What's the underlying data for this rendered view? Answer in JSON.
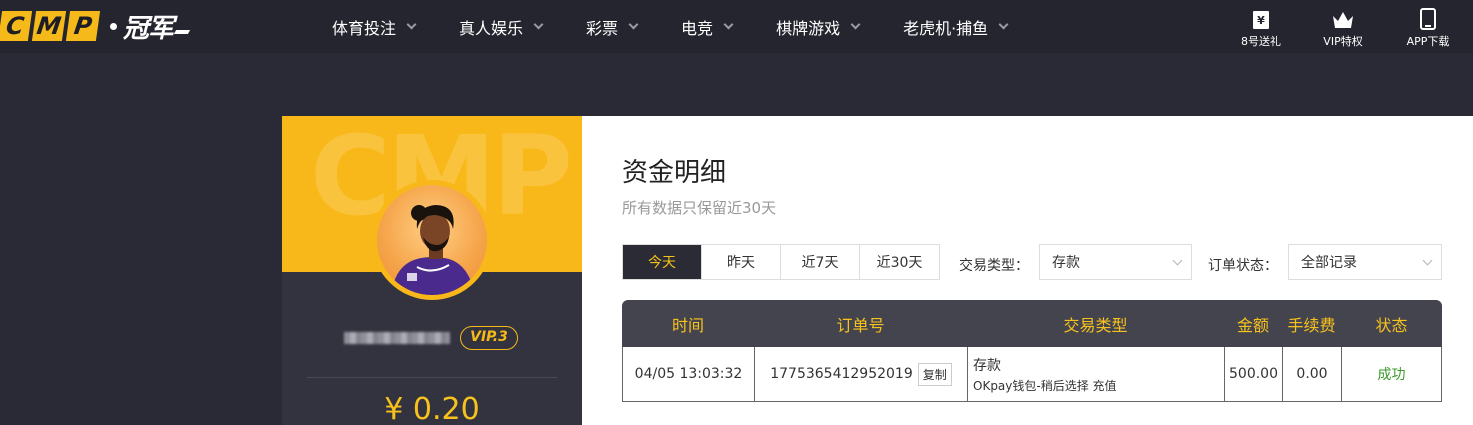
{
  "brand": {
    "logo_letters": [
      "C",
      "M",
      "P"
    ],
    "logo_cn": "冠军"
  },
  "nav": {
    "items": [
      {
        "label": "体育投注"
      },
      {
        "label": "真人娱乐"
      },
      {
        "label": "彩票"
      },
      {
        "label": "电竞"
      },
      {
        "label": "棋牌游戏"
      },
      {
        "label": "老虎机·捕鱼"
      }
    ]
  },
  "header_right": {
    "gift_label": "8号送礼",
    "vip_label": "VIP特权",
    "app_label": "APP下载"
  },
  "profile": {
    "banner_watermark": "CMP",
    "vip_level": "VIP.3",
    "balance": "¥ 0.20"
  },
  "page": {
    "title": "资金明细",
    "subtitle": "所有数据只保留近30天"
  },
  "filters": {
    "range_tabs": [
      "今天",
      "昨天",
      "近7天",
      "近30天"
    ],
    "active_range": "今天",
    "type_label": "交易类型：",
    "type_value": "存款",
    "status_label": "订单状态：",
    "status_value": "全部记录"
  },
  "table": {
    "headers": [
      "时间",
      "订单号",
      "交易类型",
      "金额",
      "手续费",
      "状态"
    ],
    "rows": [
      {
        "time": "04/05 13:03:32",
        "order_no": "1775365412952019",
        "copy_label": "复制",
        "type_main": "存款",
        "type_detail": "OKpay钱包-稍后选择 充值",
        "amount": "500.00",
        "fee": "0.00",
        "status": "成功"
      }
    ]
  },
  "colors": {
    "accent_yellow": "#f8c21c",
    "header_bg": "#25252f",
    "page_bg": "#2a2a36",
    "success_green": "#3a9a2a"
  }
}
